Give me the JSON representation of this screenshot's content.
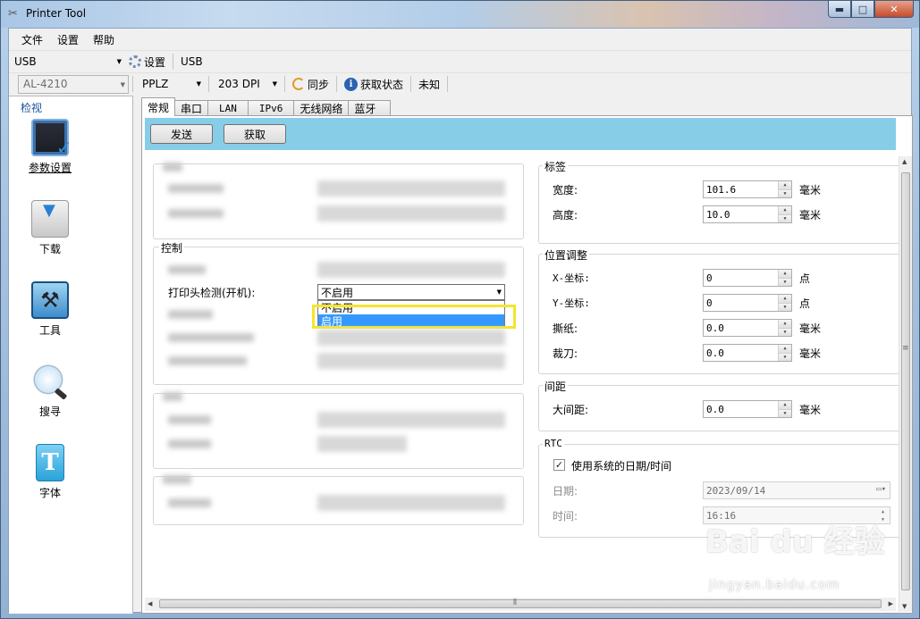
{
  "window": {
    "title": "Printer Tool",
    "min_glyph": "▬",
    "max_glyph": "□",
    "close_glyph": "✕"
  },
  "menu": [
    "文件",
    "设置",
    "帮助"
  ],
  "toolbar1": {
    "connection": "USB",
    "settings_label": "设置",
    "port_label": "USB"
  },
  "toolbar2": {
    "printer_model": "AL-4210",
    "language": "PPLZ",
    "dpi": "203 DPI",
    "sync_label": "同步",
    "status_label": "获取状态",
    "status_value": "未知"
  },
  "sidebar": {
    "title": "检视",
    "items": [
      {
        "label": "参数设置",
        "icon": "parameter-settings-icon"
      },
      {
        "label": "下载",
        "icon": "download-printer-icon"
      },
      {
        "label": "工具",
        "icon": "tools-icon"
      },
      {
        "label": "搜寻",
        "icon": "search-magnifier-icon"
      },
      {
        "label": "字体",
        "icon": "font-icon",
        "glyph": "T"
      }
    ]
  },
  "tabs": [
    "常规",
    "串口",
    "LAN",
    "IPv6",
    "无线网络",
    "蓝牙"
  ],
  "actions": {
    "send": "发送",
    "get": "获取"
  },
  "left": {
    "control_group": "控制",
    "printhead_check_label": "打印头检测(开机):",
    "printhead_check_value": "不启用",
    "dropdown_options": [
      "不启用",
      "启用"
    ]
  },
  "right": {
    "label_group": {
      "title": "标签",
      "fields": [
        {
          "label": "宽度:",
          "value": "101.6",
          "unit": "毫米"
        },
        {
          "label": "高度:",
          "value": "10.0",
          "unit": "毫米"
        }
      ]
    },
    "position_group": {
      "title": "位置调整",
      "fields": [
        {
          "label": "X-坐标:",
          "value": "0",
          "unit": "点"
        },
        {
          "label": "Y-坐标:",
          "value": "0",
          "unit": "点"
        },
        {
          "label": "撕纸:",
          "value": "0.0",
          "unit": "毫米"
        },
        {
          "label": "裁刀:",
          "value": "0.0",
          "unit": "毫米"
        }
      ]
    },
    "gap_group": {
      "title": "间距",
      "fields": [
        {
          "label": "大间距:",
          "value": "0.0",
          "unit": "毫米"
        }
      ]
    },
    "rtc_group": {
      "title": "RTC",
      "use_system_label": "使用系统的日期/时间",
      "use_system_checked": true,
      "date_label": "日期:",
      "date_value": "2023/09/14",
      "time_label": "时间:",
      "time_value": "16:16"
    }
  },
  "watermark": {
    "main": "Bai du 经验",
    "sub": "jingyan.baidu.com"
  },
  "colors": {
    "accent_bar": "#87cde8",
    "selection": "#3399ff",
    "highlight": "#f3e62c"
  }
}
